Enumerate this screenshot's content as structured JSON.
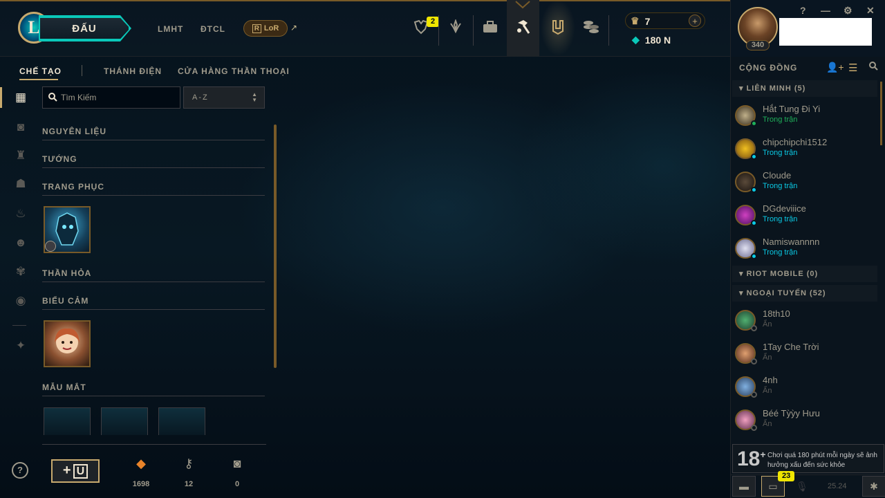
{
  "topnav": {
    "play_label": "ĐẤU",
    "links": [
      "LMHT",
      "ĐTCL"
    ],
    "lor_label": "LoR",
    "lor_arrow": "↗",
    "missions_badge": "2",
    "rp": "7",
    "be": "180 N"
  },
  "profile": {
    "level": "340"
  },
  "window": {
    "help": "?",
    "minimize": "—",
    "settings": "⚙",
    "close": "✕"
  },
  "subnav": {
    "tabs": [
      "CHẾ TẠO",
      "THÁNH ĐIỆN",
      "CỬA HÀNG THẦN THOẠI"
    ]
  },
  "filter": {
    "search_placeholder": "Tìm Kiếm",
    "sort_value": "A-Z"
  },
  "categories": [
    "NGUYÊN LIỆU",
    "TƯỚNG",
    "TRANG PHỤC",
    "THẦN HỎA",
    "BIỂU CẢM",
    "MẪU MẮT"
  ],
  "stats": {
    "orange_essence": "1698",
    "keys": "12",
    "chests": "0",
    "craft_label": "+"
  },
  "social": {
    "title": "CỘNG ĐỒNG",
    "groups": [
      {
        "label": "LIÊN MINH (5)"
      },
      {
        "label": "RIOT MOBILE (0)"
      },
      {
        "label": "NGOẠI TUYẾN (52)"
      }
    ],
    "online": [
      {
        "name": "Hắt Tung Đi Yi",
        "status": "Trong trận"
      },
      {
        "name": "chipchipchi1512",
        "status": "Trong trận"
      },
      {
        "name": "Cloude",
        "status": "Trong trận"
      },
      {
        "name": "DGdeviiice",
        "status": "Trong trận"
      },
      {
        "name": "Namiswannnn",
        "status": "Trong trận"
      }
    ],
    "offline": [
      {
        "name": "18th10",
        "status": "Ẩn"
      },
      {
        "name": "1Tay Che Trời",
        "status": "Ẩn"
      },
      {
        "name": "4nh",
        "status": "Ẩn"
      },
      {
        "name": "Béé Tỳỳy Hưu",
        "status": "Ẩn"
      }
    ],
    "rating": {
      "age": "18",
      "plus": "+",
      "text": "Chơi quá 180 phút mỗi ngày sẽ ảnh hưởng xấu đến sức khỏe"
    },
    "chat_badge": "23",
    "version": "25.24"
  },
  "colors": {
    "gold": "#c8aa6e",
    "teal": "#0ac8b9",
    "ingame_green": "#0acbe6",
    "first_status": "#1fb05a"
  }
}
